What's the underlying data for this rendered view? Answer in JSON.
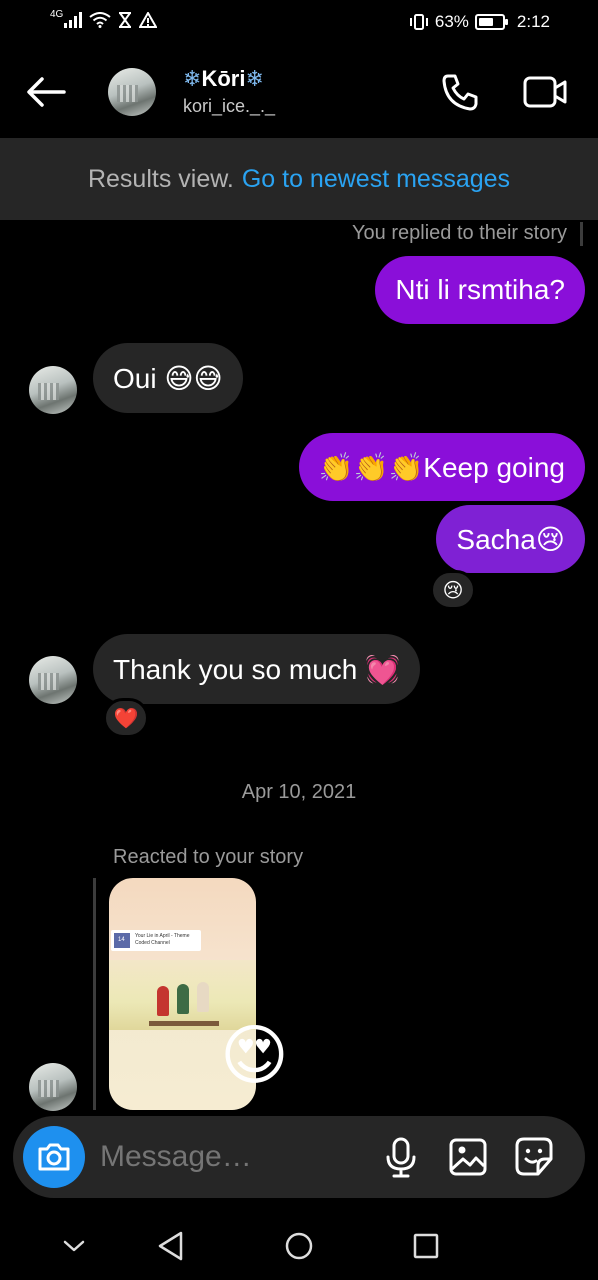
{
  "status_bar": {
    "network": "4G",
    "battery_percent": "63%",
    "battery_level": 0.63,
    "time": "2:12"
  },
  "header": {
    "name_prefix": "❄",
    "name": "Kōri",
    "name_suffix": "❄",
    "username": "kori_ice._._",
    "icons": [
      "back-arrow-icon",
      "phone-call-icon",
      "video-call-icon"
    ]
  },
  "banner": {
    "text": "Results view.",
    "link": "Go to newest messages"
  },
  "messages": {
    "story_reply_note": "You replied to their story",
    "m1": "Nti li rsmtiha?",
    "m2": "Oui 😅😅",
    "m3": "👏👏👏Keep going",
    "m4": "Sacha😢",
    "m4_reaction": "😢",
    "m5": "Thank you so much 💓",
    "m5_reaction": "❤️",
    "date_separator": "Apr 10, 2021",
    "story_reaction_note": "Reacted to your story",
    "story_card_title": "Your Lie in April - Theme",
    "story_card_channel": "Coded Channel",
    "story_card_thumb_number": "14",
    "story_emoji": "😍"
  },
  "composer": {
    "placeholder": "Message…",
    "icons": [
      "camera-icon",
      "microphone-icon",
      "gallery-icon",
      "sticker-icon"
    ]
  },
  "nav": {
    "icons": [
      "chevron-down-icon",
      "nav-back-icon",
      "nav-home-icon",
      "nav-recents-icon"
    ]
  },
  "colors": {
    "outgoing_bubble": "#8a0fd9",
    "incoming_bubble": "#262626",
    "link": "#2aa3f2",
    "camera_button": "#1e90ef"
  }
}
